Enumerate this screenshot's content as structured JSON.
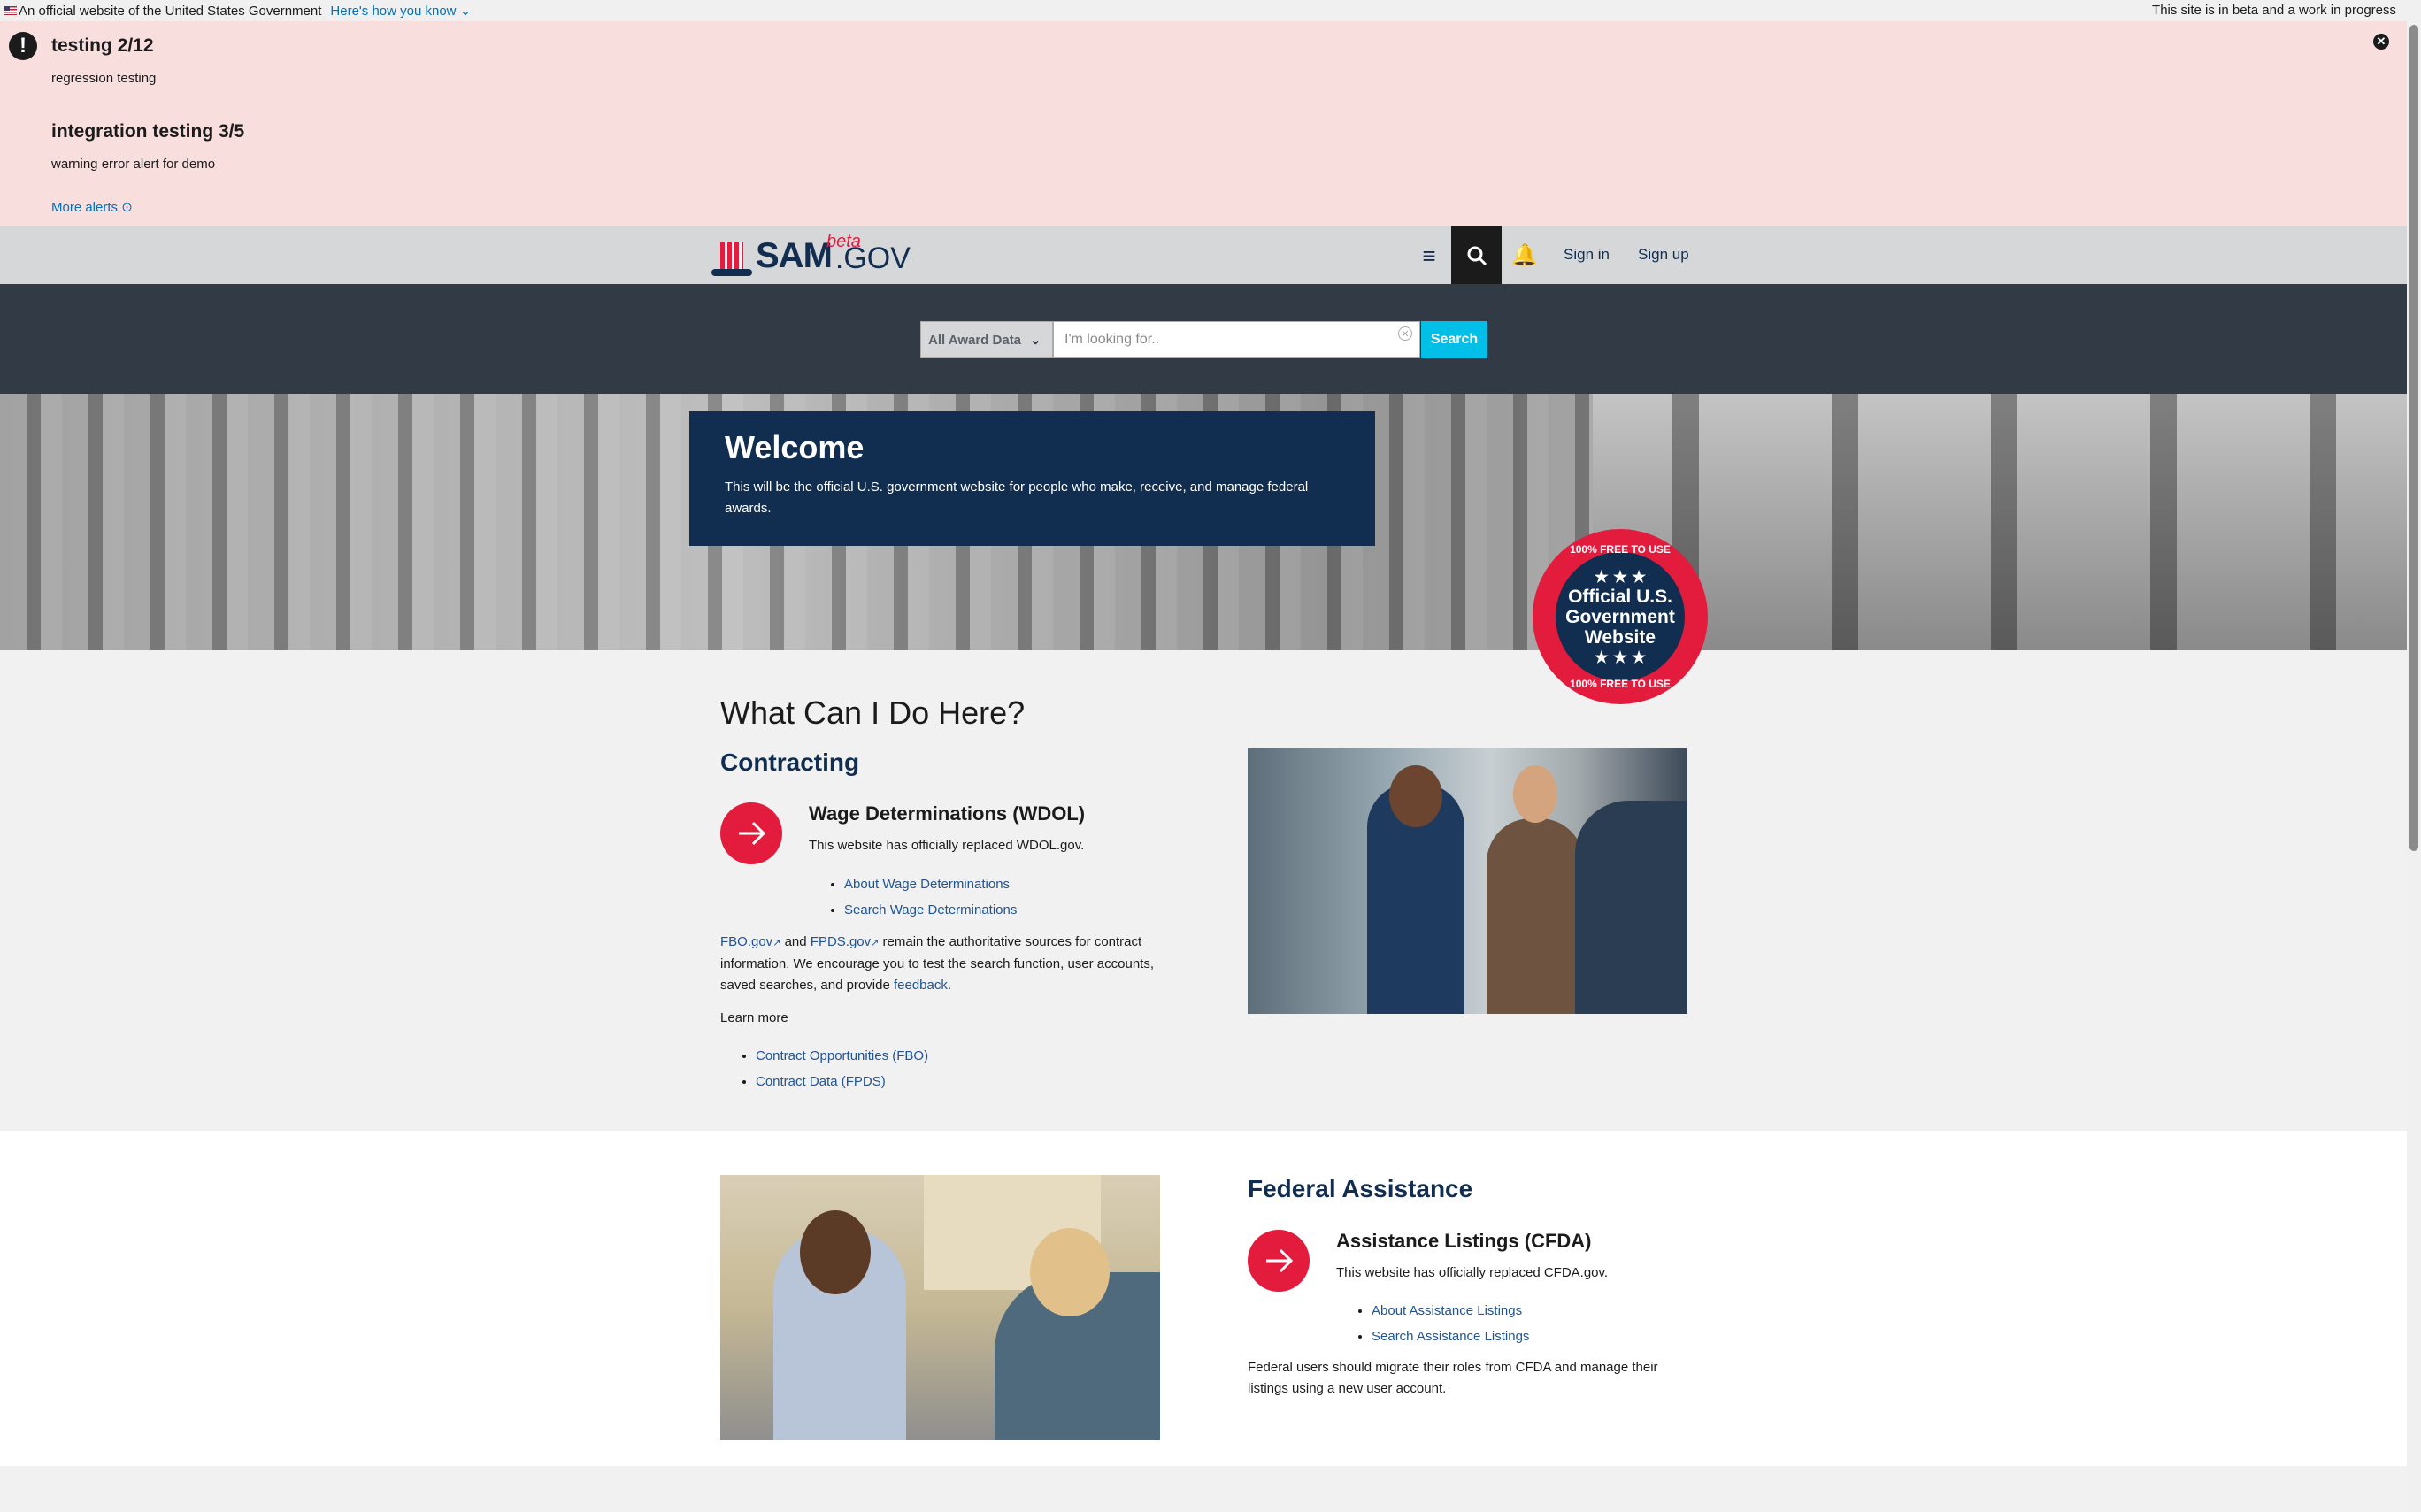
{
  "gov_banner": {
    "official_text": "An official website of the United States Government",
    "how_link": "Here's how you know",
    "beta_note": "This site is in beta and a work in progress"
  },
  "alerts": {
    "items": [
      {
        "title": "testing 2/12",
        "body": "regression testing"
      },
      {
        "title": "integration testing 3/5",
        "body": "warning error alert for demo"
      }
    ],
    "more_link": "More alerts"
  },
  "header": {
    "logo_sam": "SAM",
    "logo_gov": ".GOV",
    "logo_beta": "beta",
    "signin": "Sign in",
    "signup": "Sign up"
  },
  "search": {
    "domain": "All Award Data",
    "placeholder": "I'm looking for..",
    "value": "",
    "submit": "Search"
  },
  "hero": {
    "title": "Welcome",
    "body": "This will be the official U.S. government website for people who make, receive, and manage federal awards.",
    "seal_top": "100% FREE TO USE",
    "seal_main": "Official U.S. Government Website",
    "seal_bottom": "100% FREE TO USE"
  },
  "contracting": {
    "heading": "What Can I Do Here?",
    "subheading": "Contracting",
    "wdol_title": "Wage Determinations (WDOL)",
    "wdol_body": "This website has officially replaced WDOL.gov.",
    "wdol_links": [
      "About Wage Determinations",
      "Search Wage Determinations"
    ],
    "fbo_link": "FBO.gov",
    "and_text": "and",
    "fpds_link": "FPDS.gov",
    "fbo_body": "remain the authoritative sources for contract information. We encourage you to test the search function, user accounts, saved searches, and provide",
    "feedback_link": "feedback",
    "learn_more": "Learn more",
    "learn_links": [
      "Contract Opportunities (FBO)",
      "Contract Data (FPDS)"
    ]
  },
  "assistance": {
    "heading": "Federal Assistance",
    "cfda_title": "Assistance Listings (CFDA)",
    "cfda_body": "This website has officially replaced CFDA.gov.",
    "cfda_links": [
      "About Assistance Listings",
      "Search Assistance Listings"
    ],
    "migrate_body": "Federal users should migrate their roles from CFDA and manage their listings using a new user account."
  },
  "colors": {
    "primary_navy": "#112e51",
    "accent_red": "#e31c3d",
    "search_button": "#02bfe7",
    "alert_bg": "#f9dede",
    "header_bg": "#d6d7d9",
    "search_band": "#323a45"
  }
}
